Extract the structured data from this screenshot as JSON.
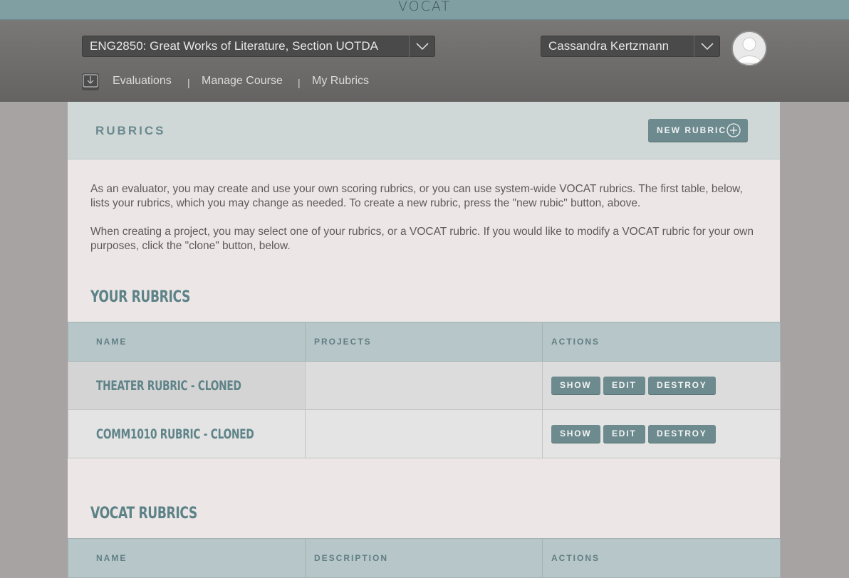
{
  "app": {
    "logo": "VOCAT"
  },
  "header": {
    "course_select": "ENG2850: Great Works of Literature, Section UOTDA",
    "user_select": "Cassandra Kertzmann",
    "nav": [
      "Evaluations",
      "Manage Course",
      "My Rubrics"
    ],
    "nav_separator": "|"
  },
  "page": {
    "title": "RUBRICS",
    "new_button": "NEW RUBRIC",
    "intro": [
      "As an evaluator, you may create and use your own scoring rubrics, or you can use system-wide VOCAT rubrics. The first table, below, lists your rubrics, which you may change as needed. To create a new rubric, press the \"new rubic\" button, above.",
      "When creating a project, you may select one of your rubrics, or a VOCAT rubric. If you would like to modify a VOCAT rubric for your own purposes, click the \"clone\" button, below."
    ]
  },
  "your_rubrics": {
    "title": "YOUR RUBRICS",
    "columns": [
      "NAME",
      "PROJECTS",
      "ACTIONS"
    ],
    "rows": [
      {
        "name": "THEATER RUBRIC - CLONED",
        "projects": ""
      },
      {
        "name": "COMM1010 RUBRIC - CLONED",
        "projects": ""
      }
    ],
    "actions": [
      "SHOW",
      "EDIT",
      "DESTROY"
    ]
  },
  "vocat_rubrics": {
    "title": "VOCAT RUBRICS",
    "columns": [
      "NAME",
      "DESCRIPTION",
      "ACTIONS"
    ]
  },
  "colors": {
    "accent": "#6d8b8f",
    "header_bg": "#6f6d6c",
    "topbar_bg": "#7f9fa3"
  }
}
